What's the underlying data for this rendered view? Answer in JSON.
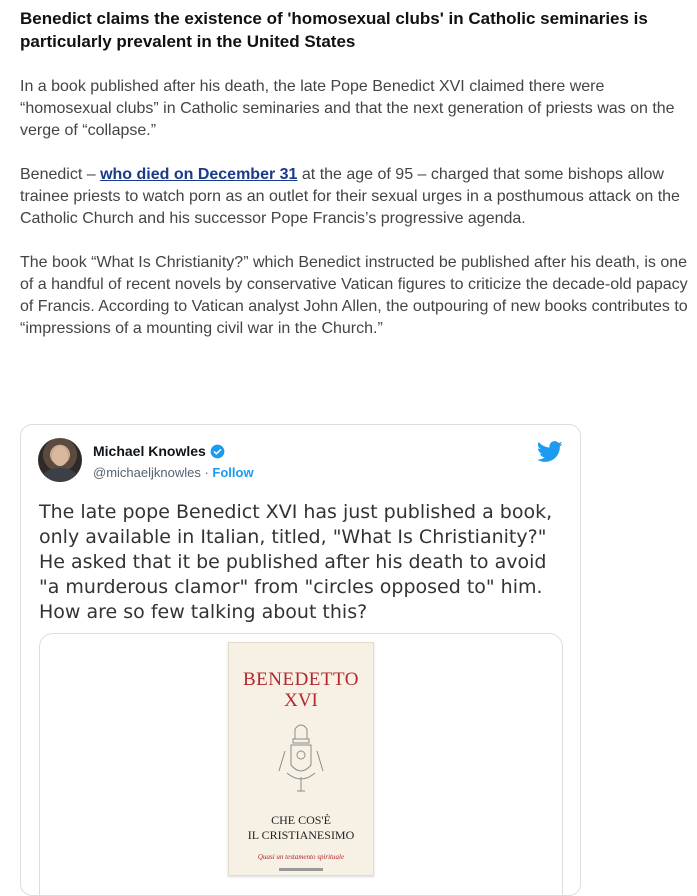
{
  "article": {
    "headline": "Benedict claims the existence of 'homosexual clubs' in Catholic seminaries is particularly prevalent in the United States",
    "p1": "In a book published after his death, the late Pope Benedict XVI claimed there were “homosexual clubs” in Catholic seminaries and that the next generation of priests was on the verge of “collapse.”",
    "p2_before": "Benedict – ",
    "p2_link": "who died on December 31",
    "p2_after": " at the age of 95 – charged that some bishops allow trainee priests to watch porn as an outlet for their sexual urges in a posthumous attack on the Catholic Church and his successor Pope Francis’s progressive agenda.",
    "p3": "The book “What Is Christianity?” which Benedict instructed be published after his death, is one of a handful of recent novels by conservative Vatican figures to criticize the decade-old papacy of Francis. According to Vatican analyst John Allen, the outpouring of new books contributes to “impressions of a mounting civil war in the Church.”"
  },
  "tweet": {
    "name": "Michael Knowles",
    "handle": "@michaeljknowles",
    "separator": " · ",
    "follow": "Follow",
    "text": "The late pope Benedict XVI has just published a book, only available in Italian, titled, \"What Is Christianity?\" He asked that it be published after his death to avoid \"a murderous clamor\" from \"circles opposed to\" him. How are so few talking about this?",
    "brand_color": "#1d9bf0"
  },
  "book": {
    "author": "BENEDETTO",
    "volume": "XVI",
    "title_line1": "CHE COS'È",
    "title_line2": "IL CRISTIANESIMO",
    "subtitle": "Quasi un testamento spirituale"
  }
}
